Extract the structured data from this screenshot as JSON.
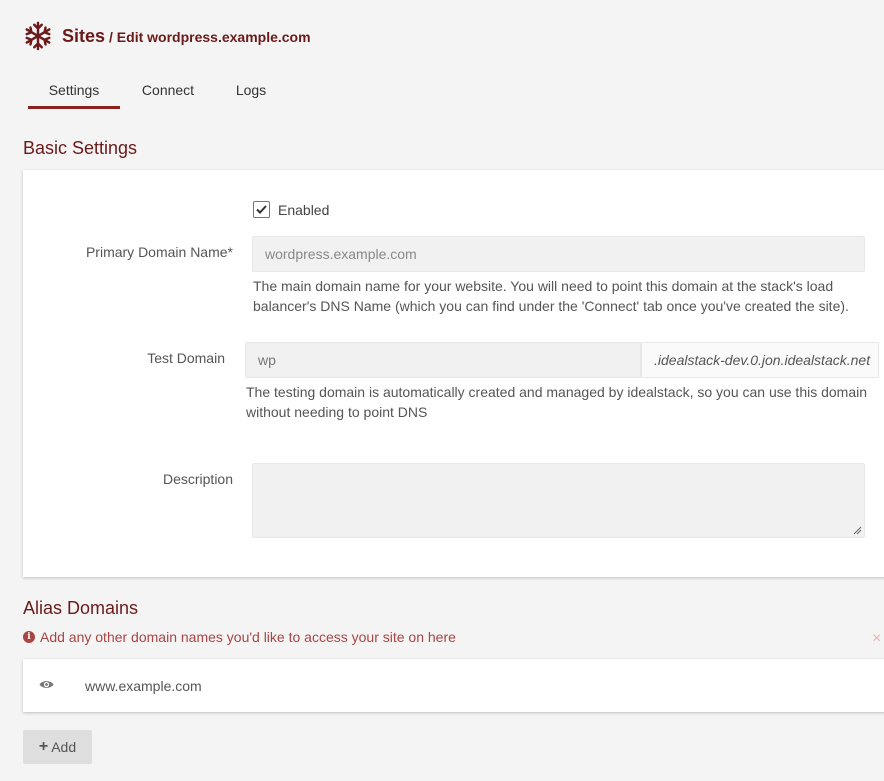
{
  "header": {
    "logo_icon": "snowflake-icon",
    "title": "Sites",
    "breadcrumb": "/ Edit wordpress.example.com",
    "brand_color": "#6b1a1a"
  },
  "tabs": [
    {
      "label": "Settings",
      "active": true
    },
    {
      "label": "Connect",
      "active": false
    },
    {
      "label": "Logs",
      "active": false
    }
  ],
  "basic_settings": {
    "title": "Basic Settings",
    "enabled_label": "Enabled",
    "enabled_checked": true,
    "primary_domain": {
      "label": "Primary Domain Name*",
      "value": "wordpress.example.com",
      "help_line1": "The main domain name for your website. You will need to point this domain at the stack's load",
      "help_line2": "balancer's DNS Name (which you can find under the 'Connect' tab once you've created the site)."
    },
    "test_domain": {
      "label": "Test Domain",
      "value": "wp",
      "suffix": ".idealstack-dev.0.jon.idealstack.net",
      "help_line1": "The testing domain is automatically created and managed by idealstack, so you can use this domain",
      "help_line2": "without needing to point DNS"
    },
    "description": {
      "label": "Description",
      "value": ""
    }
  },
  "alias_domains": {
    "title": "Alias Domains",
    "info_icon": "info-circle-icon",
    "info": "Add any other domain names you'd like to access your site on here",
    "dismiss": "×",
    "items": [
      {
        "icon": "eye-icon",
        "domain": "www.example.com"
      }
    ],
    "add_label": "Add"
  }
}
